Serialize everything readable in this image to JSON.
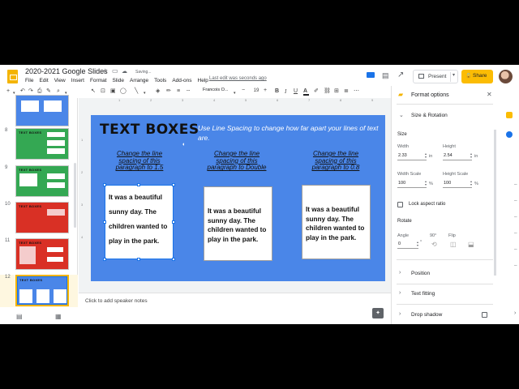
{
  "app": {
    "doc_title": "2020-2021 Google Slides",
    "saving_status": "Saving...",
    "last_edit": "Last edit was seconds ago",
    "menu": [
      "File",
      "Edit",
      "View",
      "Insert",
      "Format",
      "Slide",
      "Arrange",
      "Tools",
      "Add-ons",
      "Help"
    ],
    "present_label": "Present",
    "share_label": "Share",
    "colors": {
      "accent": "#1a73e8",
      "share": "#fbbc04",
      "slide_bg": "#4a86e8"
    }
  },
  "toolbar": {
    "font": "Francois O...",
    "font_size": "19"
  },
  "filmstrip": {
    "slides": [
      {
        "num": "8",
        "color": "#34a853",
        "title": "TEXT BOXES"
      },
      {
        "num": "9",
        "color": "#34a853",
        "title": "TEXT BOXES"
      },
      {
        "num": "10",
        "color": "#d93025",
        "title": "TEXT BOXES"
      },
      {
        "num": "11",
        "color": "#d93025",
        "title": "TEXT BOXES"
      },
      {
        "num": "12",
        "color": "#4a86e8",
        "title": "TEXT BOXES"
      }
    ]
  },
  "slide": {
    "title": "TEXT BOXES",
    "subtitle": "Use Line Spacing to change how far apart your lines of text are.",
    "columns": [
      {
        "heading": "Change the line spacing of this paragraph to 1.5",
        "body": "It was a beautiful sunny day.  The children wanted to play in the park."
      },
      {
        "heading": "Change the line spacing of this paragraph to Double",
        "body": "It was a beautiful sunny day.  The children wanted to play in the park."
      },
      {
        "heading": "Change the line spacing of this paragraph to 0.8",
        "body": "It was a beautiful sunny day.  The children wanted to play in the park."
      }
    ]
  },
  "notes_placeholder": "Click to add speaker notes",
  "panel": {
    "title": "Format options",
    "size_rotation": "Size & Rotation",
    "size_label": "Size",
    "width_label": "Width",
    "width_value": "2.33",
    "height_label": "Height",
    "height_value": "2.54",
    "unit_in": "in",
    "width_scale_label": "Width Scale",
    "width_scale_value": "100",
    "height_scale_label": "Height Scale",
    "height_scale_value": "100",
    "unit_pct": "%",
    "lock_label": "Lock aspect ratio",
    "rotate_label": "Rotate",
    "angle_label": "Angle",
    "angle_value": "0",
    "angle_unit": "°",
    "rot90_label": "90°",
    "flip_label": "Flip",
    "position_label": "Position",
    "text_fitting_label": "Text fitting",
    "drop_shadow_label": "Drop shadow"
  }
}
